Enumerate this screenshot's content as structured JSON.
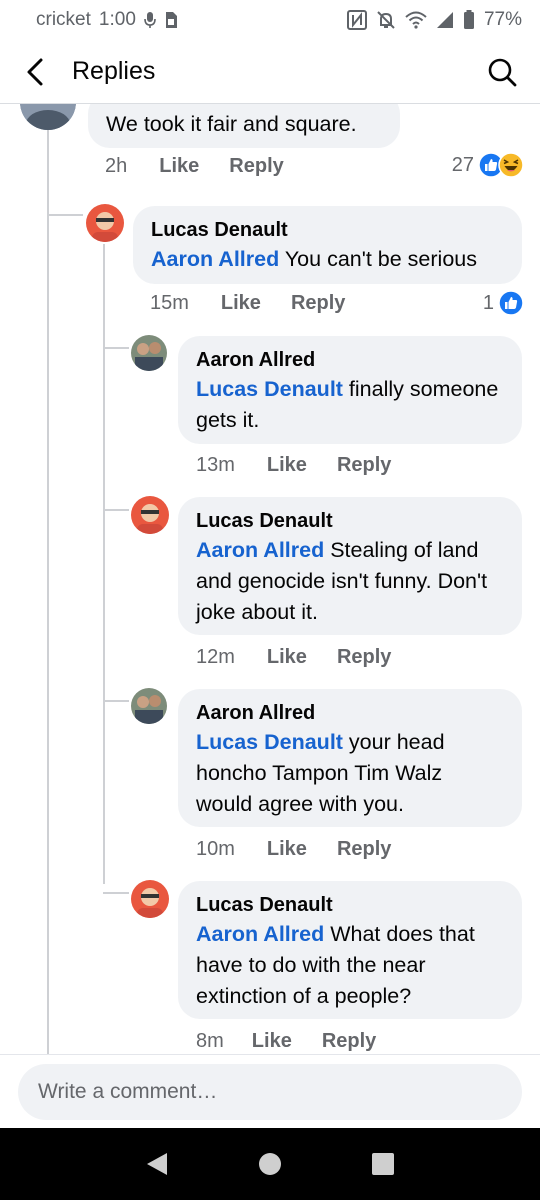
{
  "status_bar": {
    "carrier": "cricket",
    "time": "1:00",
    "battery": "77%",
    "icons": [
      "mic-icon",
      "sim-icon",
      "nfc-icon",
      "mute-icon",
      "wifi-icon",
      "signal-icon",
      "battery-icon"
    ]
  },
  "header": {
    "title": "Replies",
    "back_icon": "back-arrow-icon",
    "search_icon": "search-icon"
  },
  "comments": [
    {
      "author": "",
      "mention": "",
      "text": "We took it fair and square.",
      "time": "2h",
      "like": "Like",
      "reply": "Reply",
      "reaction_count": "27",
      "reactions": [
        "like-icon",
        "haha-icon"
      ]
    },
    {
      "author": "Lucas Denault",
      "mention": "Aaron Allred",
      "text": " You can't be serious",
      "time": "15m",
      "like": "Like",
      "reply": "Reply",
      "reaction_count": "1",
      "reactions": [
        "like-icon"
      ]
    },
    {
      "author": "Aaron Allred",
      "mention": "Lucas Denault",
      "text": " finally someone gets it.",
      "time": "13m",
      "like": "Like",
      "reply": "Reply"
    },
    {
      "author": "Lucas Denault",
      "mention": "Aaron Allred",
      "text": " Stealing of land and genocide isn't funny. Don't joke about it.",
      "time": "12m",
      "like": "Like",
      "reply": "Reply"
    },
    {
      "author": "Aaron Allred",
      "mention": "Lucas Denault",
      "text": " your head honcho Tampon Tim Walz would agree with you.",
      "time": "10m",
      "like": "Like",
      "reply": "Reply"
    },
    {
      "author": "Lucas Denault",
      "mention": "Aaron Allred",
      "text": " What does that have to do with the near extinction of a people?",
      "time": "8m",
      "like": "Like",
      "reply": "Reply"
    }
  ],
  "composer": {
    "placeholder": "Write a comment…"
  },
  "nav_bar": {
    "icons": [
      "nav-back-icon",
      "nav-home-icon",
      "nav-recents-icon"
    ]
  },
  "colors": {
    "mention": "#1763cf",
    "bubble": "#f0f2f5",
    "meta": "#65676b",
    "like_blue": "#1877f2",
    "haha_yellow": "#f7b928"
  }
}
